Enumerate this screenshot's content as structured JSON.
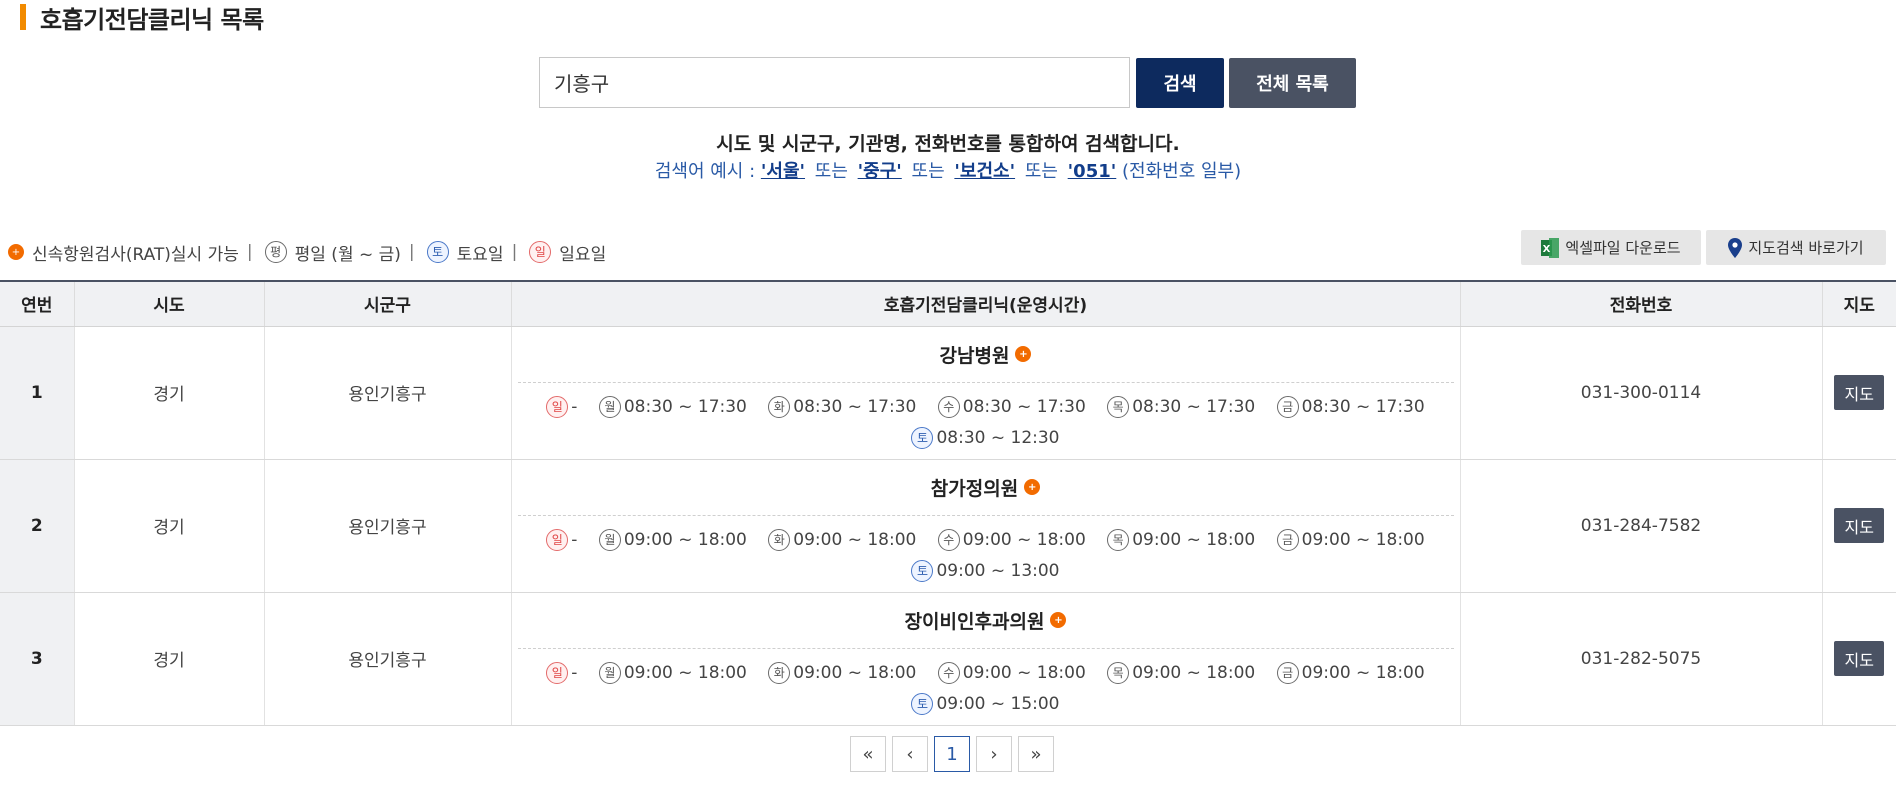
{
  "page": {
    "title": "호흡기전담클리닉 목록"
  },
  "search": {
    "value": "기흥구",
    "button_label": "검색",
    "all_list_label": "전체 목록",
    "description": "시도 및 시군구, 기관명, 전화번호를 통합하여 검색합니다.",
    "example_prefix": "검색어 예시 :",
    "example_kw1": "'서울'",
    "example_kw2": "'중구'",
    "example_kw3": "'보건소'",
    "example_kw4": "'051'",
    "or_text": "또는",
    "example_suffix": "(전화번호 일부)"
  },
  "legend": {
    "rat_label": "신속항원검사(RAT)실시 가능",
    "weekday_icon": "평",
    "weekday_label": "평일 (월 ~ 금)",
    "saturday_icon": "토",
    "saturday_label": "토요일",
    "sunday_icon": "일",
    "sunday_label": "일요일",
    "pipe": "|"
  },
  "actions": {
    "excel_label": "엑셀파일 다운로드",
    "map_search_label": "지도검색 바로가기"
  },
  "table": {
    "headers": [
      "연번",
      "시도",
      "시군구",
      "호흡기전담클리닉(운영시간)",
      "전화번호",
      "지도"
    ],
    "map_button": "지도",
    "rows": [
      {
        "no": "1",
        "sido": "경기",
        "sigungu": "용인기흥구",
        "name": "강남병원",
        "phone": "031-300-0114",
        "sun": "-",
        "mon": "08:30 ~ 17:30",
        "tue": "08:30 ~ 17:30",
        "wed": "08:30 ~ 17:30",
        "thu": "08:30 ~ 17:30",
        "fri": "08:30 ~ 17:30",
        "sat": "08:30 ~ 12:30"
      },
      {
        "no": "2",
        "sido": "경기",
        "sigungu": "용인기흥구",
        "name": "참가정의원",
        "phone": "031-284-7582",
        "sun": "-",
        "mon": "09:00 ~ 18:00",
        "tue": "09:00 ~ 18:00",
        "wed": "09:00 ~ 18:00",
        "thu": "09:00 ~ 18:00",
        "fri": "09:00 ~ 18:00",
        "sat": "09:00 ~ 13:00"
      },
      {
        "no": "3",
        "sido": "경기",
        "sigungu": "용인기흥구",
        "name": "장이비인후과의원",
        "phone": "031-282-5075",
        "sun": "-",
        "mon": "09:00 ~ 18:00",
        "tue": "09:00 ~ 18:00",
        "wed": "09:00 ~ 18:00",
        "thu": "09:00 ~ 18:00",
        "fri": "09:00 ~ 18:00",
        "sat": "09:00 ~ 15:00"
      }
    ]
  },
  "day_icons": {
    "sun": "일",
    "mon": "월",
    "tue": "화",
    "wed": "수",
    "thu": "목",
    "fri": "금",
    "sat": "토"
  },
  "pagination": {
    "first": "«",
    "prev": "‹",
    "current": "1",
    "next": "›",
    "last": "»"
  },
  "colors": {
    "accent": "#f28b00",
    "primary": "#0d2a5e",
    "secondary": "#4a5263",
    "rat": "#f26b00"
  }
}
